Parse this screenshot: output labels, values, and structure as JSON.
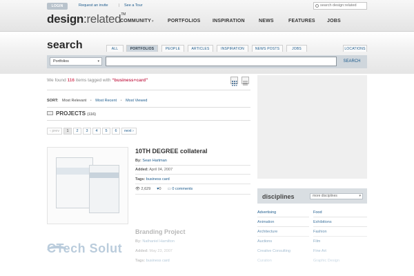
{
  "topbar": {
    "login_label": "LOGIN",
    "request_invite": "Request an invite",
    "separator": "|",
    "see_tour": "See a Tour",
    "search_placeholder": "search design:related"
  },
  "logo": {
    "bold": "design",
    "sep": ":",
    "light": "related",
    "tm": "TM"
  },
  "nav": {
    "community": "COMMUNITY",
    "community_arrow": "▾",
    "portfolios": "PORTFOLIOS",
    "inspiration": "INSPIRATION",
    "news": "NEWS",
    "features": "FEATURES",
    "jobs": "JOBS"
  },
  "search": {
    "title": "search",
    "tabs": {
      "all": "ALL",
      "portfolios": "PORTFOLIOS",
      "people": "PEOPLE",
      "articles": "ARTICLES",
      "inspiration": "INSPIRATION",
      "news_posts": "NEWS POSTS",
      "jobs": "JOBS",
      "locations": "LOCATIONS"
    },
    "active_tab": "portfolios",
    "scope_selected": "Portfolios",
    "query_value": "",
    "button_label": "SEARCH"
  },
  "results": {
    "prefix": "We found",
    "count": "116",
    "middle": "items tagged with",
    "query": "“business+card”",
    "sort_label": "SORT:",
    "sort_current": "Most Relevant",
    "sort_recent": "Most Recent",
    "sort_viewed": "Most Viewed",
    "sort_dot": "•",
    "section_title": "PROJECTS",
    "section_count": "(116)",
    "pager": {
      "prev": "prev",
      "p1": "1",
      "p2": "2",
      "p3": "3",
      "p4": "4",
      "p5": "5",
      "p6": "6",
      "next": "next"
    }
  },
  "items": [
    {
      "title": "10TH DEGREE collateral",
      "by_label": "By:",
      "author": "Sean Hartman",
      "added_label": "Added:",
      "added": "April 04, 2007",
      "tags_label": "Tags:",
      "tags": "business card",
      "views": "2,629",
      "favorites": "0",
      "comments": "0 comments"
    },
    {
      "title": "Branding Project",
      "by_label": "By:",
      "author": "Nathaniel Hamilton",
      "added_label": "Added:",
      "added": "May 23, 2007",
      "tags_label": "Tags:",
      "tags": "business card",
      "logo_text": "CTech Solut"
    }
  ],
  "sidebar": {
    "disciplines_title": "disciplines",
    "disciplines_select": "more disciplines",
    "col1": [
      "Advertising",
      "Animation",
      "Architecture",
      "Auctions",
      "Creative Consulting",
      "Curation"
    ],
    "col2": [
      "Food",
      "Exhibitions",
      "Fashion",
      "Film",
      "Fine Art",
      "Graphic Design"
    ]
  },
  "colors": {
    "accent": "#1b5a8c",
    "highlight": "#d84c68",
    "tab_active": "#cdd6de"
  }
}
